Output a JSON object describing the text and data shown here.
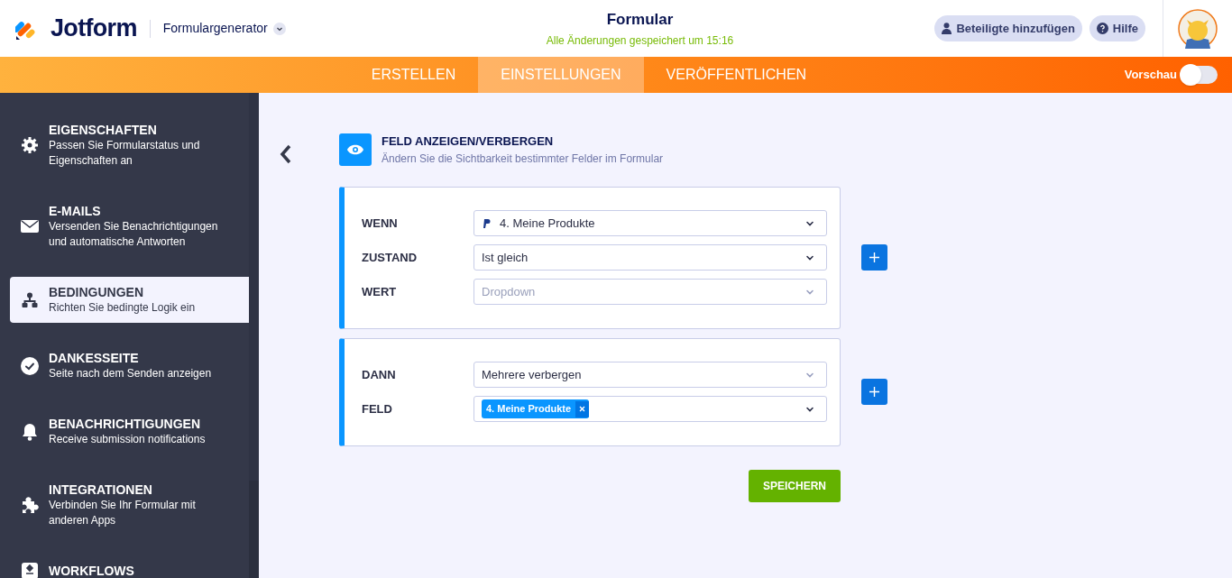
{
  "header": {
    "logo": "Jotform",
    "builder": "Formulargenerator",
    "title": "Formular",
    "saved": "Alle Änderungen gespeichert um 15:16",
    "buttons": [
      {
        "kind": "person",
        "label": "Beteiligte hinzufügen"
      },
      {
        "kind": "help",
        "label": "Hilfe"
      }
    ]
  },
  "tabs": [
    {
      "label": "ERSTELLEN",
      "selected": false
    },
    {
      "label": "EINSTELLUNGEN",
      "selected": true
    },
    {
      "label": "VERÖFFENTLICHEN",
      "selected": false
    }
  ],
  "preview": {
    "label": "Vorschau",
    "on": false
  },
  "sidebar": {
    "items": [
      {
        "kind": "gear",
        "title": "EIGENSCHAFTEN",
        "description": "Passen Sie Formularstatus und Eigenschaften an",
        "selected": false
      },
      {
        "kind": "mail",
        "title": "E-MAILS",
        "description": "Versenden Sie Benachrichtigungen und automatische Antworten",
        "selected": false
      },
      {
        "kind": "tree",
        "title": "BEDINGUNGEN",
        "description": "Richten Sie bedingte Logik ein",
        "selected": true
      },
      {
        "kind": "check",
        "title": "DANKESSEITE",
        "description": "Seite nach dem Senden anzeigen",
        "selected": false
      },
      {
        "kind": "bell",
        "title": "BENACHRICHTIGUNGEN",
        "description": "Receive submission notifications",
        "selected": false
      },
      {
        "kind": "puzzle",
        "title": "INTEGRATIONEN",
        "description": "Verbinden Sie Ihr Formular mit anderen Apps",
        "selected": false
      },
      {
        "kind": "flow",
        "title": "WORKFLOWS",
        "selected": false
      }
    ]
  },
  "condition": {
    "title": "FELD ANZEIGEN/VERBERGEN",
    "subtitle": "Ändern Sie die Sichtbarkeit bestimmter Felder im Formular",
    "if_rows": [
      {
        "label": "WENN",
        "value": "4. Meine Produkte",
        "kind": "payment"
      },
      {
        "label": "ZUSTAND",
        "value": "Ist gleich",
        "kind": "plain"
      },
      {
        "label": "WERT",
        "placeholder": "Dropdown",
        "kind": "placeholder"
      }
    ],
    "then_rows": [
      {
        "label": "DANN",
        "value": "Mehrere verbergen",
        "kind": "plain"
      },
      {
        "label": "FELD",
        "tag": "4. Meine Produkte",
        "kind": "tag"
      }
    ],
    "save": "SPEICHERN"
  }
}
